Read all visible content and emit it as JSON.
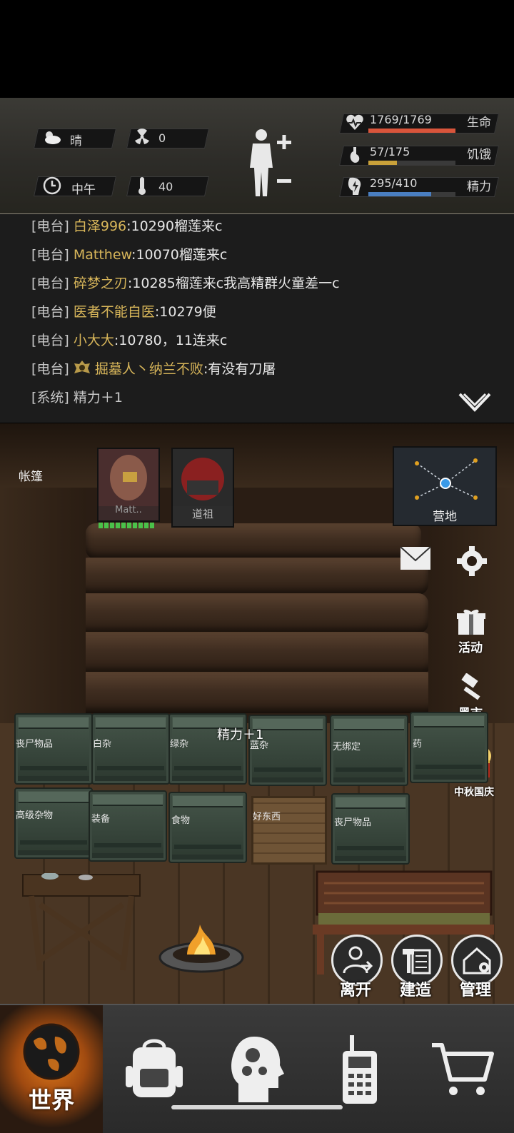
{
  "status": {
    "weather_label": "晴",
    "radiation_value": "0",
    "time_label": "中午",
    "temperature_value": "40",
    "health": {
      "text": "1769/1769",
      "label": "生命",
      "fraction": 1.0,
      "color": "#d9553b"
    },
    "hunger": {
      "text": "57/175",
      "label": "饥饿",
      "fraction": 0.326,
      "color": "#c9a13a"
    },
    "energy": {
      "text": "295/410",
      "label": "精力",
      "fraction": 0.72,
      "color": "#4a7fc2"
    }
  },
  "chat": {
    "lines": [
      {
        "channel": "[电台]",
        "sender": "白泽996",
        "message": ":10290榴莲来c"
      },
      {
        "channel": "[电台]",
        "sender": "Matthew",
        "message": ":10070榴莲来c"
      },
      {
        "channel": "[电台]",
        "sender": "碎梦之刃",
        "message": ":10285榴莲来c我高精群火童差一c"
      },
      {
        "channel": "[电台]",
        "sender": "医者不能自医",
        "message": ":10279便"
      },
      {
        "channel": "[电台]",
        "sender": "小大大",
        "message": ":10780，11连来c"
      },
      {
        "channel": "[电台]",
        "sender": "掘墓人丶纳兰不败",
        "message": ":有没有刀屠"
      },
      {
        "channel": "[系统]",
        "sender": "",
        "message": "精力＋1"
      }
    ]
  },
  "scene": {
    "location_label": "帐篷",
    "players": [
      {
        "name": "Matt.."
      },
      {
        "name": "道祖"
      }
    ],
    "map_label": "营地",
    "float_text": "精力＋1",
    "side": {
      "activity": "活动",
      "black_market": "黑市",
      "festival": "中秋国庆"
    },
    "crates_row1": [
      "丧尸物品",
      "白杂",
      "绿杂",
      "蓝杂",
      "无绑定",
      "药"
    ],
    "crates_row2": [
      "高级杂物",
      "装备",
      "食物",
      "好东西",
      "丧尸物品"
    ],
    "actions": {
      "leave": "离开",
      "build": "建造",
      "manage": "管理"
    }
  },
  "nav": {
    "world": "世界"
  }
}
